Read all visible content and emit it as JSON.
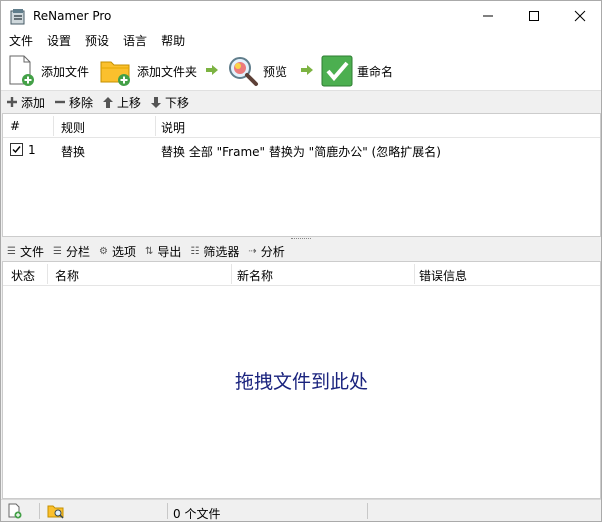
{
  "window": {
    "title": "ReNamer Pro"
  },
  "menu": [
    "文件",
    "设置",
    "预设",
    "语言",
    "帮助"
  ],
  "toolbar": {
    "add_files": "添加文件",
    "add_folder": "添加文件夹",
    "preview": "预览",
    "rename": "重命名"
  },
  "rules_toolbar": {
    "add": "添加",
    "remove": "移除",
    "move_up": "上移",
    "move_down": "下移"
  },
  "rules_table": {
    "columns": [
      "#",
      "规则",
      "说明"
    ],
    "rows": [
      {
        "checked": true,
        "index": "1",
        "rule": "替换",
        "description": "替换 全部 \"Frame\" 替换为 \"简鹿办公\" (忽略扩展名)"
      }
    ]
  },
  "files_toolbar": {
    "files": "文件",
    "columns": "分栏",
    "options": "选项",
    "export": "导出",
    "filters": "筛选器",
    "analyze": "分析"
  },
  "files_table": {
    "columns": [
      "状态",
      "名称",
      "新名称",
      "错误信息"
    ],
    "empty_hint": "拖拽文件到此处"
  },
  "statusbar": {
    "file_count": "0 个文件"
  },
  "colors": {
    "drop_hint": "#1a237e",
    "rename_green": "#4caf50",
    "arrow_green": "#7cb342"
  }
}
